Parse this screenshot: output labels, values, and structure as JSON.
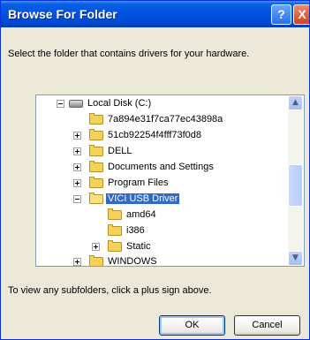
{
  "window": {
    "title": "Browse For Folder",
    "help_label": "?",
    "close_label": "X"
  },
  "instruction": "Select the folder that contains drivers for your hardware.",
  "tree": {
    "items": [
      {
        "label": "Local Disk (C:)",
        "icon": "disk-icon",
        "expander": "minus"
      },
      {
        "label": "7a894e31f7ca77ec43898a",
        "icon": "folder-icon",
        "expander": "none"
      },
      {
        "label": "51cb92254f4fff73f0d8",
        "icon": "folder-icon",
        "expander": "plus"
      },
      {
        "label": "DELL",
        "icon": "folder-icon",
        "expander": "plus"
      },
      {
        "label": "Documents and Settings",
        "icon": "folder-icon",
        "expander": "plus"
      },
      {
        "label": "Program Files",
        "icon": "folder-icon",
        "expander": "plus"
      },
      {
        "label": "VICI USB Driver",
        "icon": "open-folder-icon",
        "expander": "minus",
        "selected": true
      },
      {
        "label": "amd64",
        "icon": "folder-icon",
        "expander": "none"
      },
      {
        "label": "i386",
        "icon": "folder-icon",
        "expander": "none"
      },
      {
        "label": "Static",
        "icon": "folder-icon",
        "expander": "plus"
      },
      {
        "label": "WINDOWS",
        "icon": "folder-icon",
        "expander": "plus"
      }
    ]
  },
  "hint": "To view any subfolders, click a plus sign above.",
  "buttons": {
    "ok": "OK",
    "cancel": "Cancel"
  },
  "colors": {
    "titlebar": "#0054e3",
    "selection": "#316ac5",
    "dialog_bg": "#ece9d8"
  }
}
